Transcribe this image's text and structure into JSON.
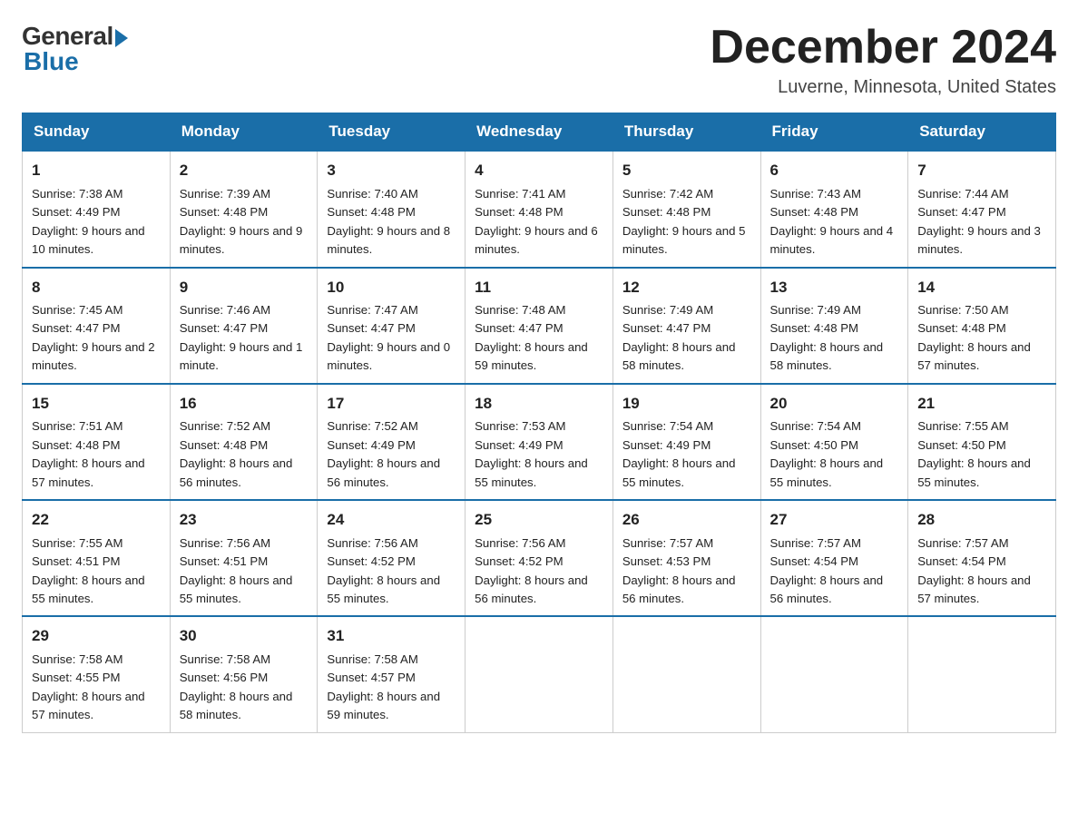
{
  "header": {
    "logo_general": "General",
    "logo_blue": "Blue",
    "month_title": "December 2024",
    "location": "Luverne, Minnesota, United States"
  },
  "days_of_week": [
    "Sunday",
    "Monday",
    "Tuesday",
    "Wednesday",
    "Thursday",
    "Friday",
    "Saturday"
  ],
  "weeks": [
    [
      {
        "day": "1",
        "sunrise": "7:38 AM",
        "sunset": "4:49 PM",
        "daylight": "9 hours and 10 minutes."
      },
      {
        "day": "2",
        "sunrise": "7:39 AM",
        "sunset": "4:48 PM",
        "daylight": "9 hours and 9 minutes."
      },
      {
        "day": "3",
        "sunrise": "7:40 AM",
        "sunset": "4:48 PM",
        "daylight": "9 hours and 8 minutes."
      },
      {
        "day": "4",
        "sunrise": "7:41 AM",
        "sunset": "4:48 PM",
        "daylight": "9 hours and 6 minutes."
      },
      {
        "day": "5",
        "sunrise": "7:42 AM",
        "sunset": "4:48 PM",
        "daylight": "9 hours and 5 minutes."
      },
      {
        "day": "6",
        "sunrise": "7:43 AM",
        "sunset": "4:48 PM",
        "daylight": "9 hours and 4 minutes."
      },
      {
        "day": "7",
        "sunrise": "7:44 AM",
        "sunset": "4:47 PM",
        "daylight": "9 hours and 3 minutes."
      }
    ],
    [
      {
        "day": "8",
        "sunrise": "7:45 AM",
        "sunset": "4:47 PM",
        "daylight": "9 hours and 2 minutes."
      },
      {
        "day": "9",
        "sunrise": "7:46 AM",
        "sunset": "4:47 PM",
        "daylight": "9 hours and 1 minute."
      },
      {
        "day": "10",
        "sunrise": "7:47 AM",
        "sunset": "4:47 PM",
        "daylight": "9 hours and 0 minutes."
      },
      {
        "day": "11",
        "sunrise": "7:48 AM",
        "sunset": "4:47 PM",
        "daylight": "8 hours and 59 minutes."
      },
      {
        "day": "12",
        "sunrise": "7:49 AM",
        "sunset": "4:47 PM",
        "daylight": "8 hours and 58 minutes."
      },
      {
        "day": "13",
        "sunrise": "7:49 AM",
        "sunset": "4:48 PM",
        "daylight": "8 hours and 58 minutes."
      },
      {
        "day": "14",
        "sunrise": "7:50 AM",
        "sunset": "4:48 PM",
        "daylight": "8 hours and 57 minutes."
      }
    ],
    [
      {
        "day": "15",
        "sunrise": "7:51 AM",
        "sunset": "4:48 PM",
        "daylight": "8 hours and 57 minutes."
      },
      {
        "day": "16",
        "sunrise": "7:52 AM",
        "sunset": "4:48 PM",
        "daylight": "8 hours and 56 minutes."
      },
      {
        "day": "17",
        "sunrise": "7:52 AM",
        "sunset": "4:49 PM",
        "daylight": "8 hours and 56 minutes."
      },
      {
        "day": "18",
        "sunrise": "7:53 AM",
        "sunset": "4:49 PM",
        "daylight": "8 hours and 55 minutes."
      },
      {
        "day": "19",
        "sunrise": "7:54 AM",
        "sunset": "4:49 PM",
        "daylight": "8 hours and 55 minutes."
      },
      {
        "day": "20",
        "sunrise": "7:54 AM",
        "sunset": "4:50 PM",
        "daylight": "8 hours and 55 minutes."
      },
      {
        "day": "21",
        "sunrise": "7:55 AM",
        "sunset": "4:50 PM",
        "daylight": "8 hours and 55 minutes."
      }
    ],
    [
      {
        "day": "22",
        "sunrise": "7:55 AM",
        "sunset": "4:51 PM",
        "daylight": "8 hours and 55 minutes."
      },
      {
        "day": "23",
        "sunrise": "7:56 AM",
        "sunset": "4:51 PM",
        "daylight": "8 hours and 55 minutes."
      },
      {
        "day": "24",
        "sunrise": "7:56 AM",
        "sunset": "4:52 PM",
        "daylight": "8 hours and 55 minutes."
      },
      {
        "day": "25",
        "sunrise": "7:56 AM",
        "sunset": "4:52 PM",
        "daylight": "8 hours and 56 minutes."
      },
      {
        "day": "26",
        "sunrise": "7:57 AM",
        "sunset": "4:53 PM",
        "daylight": "8 hours and 56 minutes."
      },
      {
        "day": "27",
        "sunrise": "7:57 AM",
        "sunset": "4:54 PM",
        "daylight": "8 hours and 56 minutes."
      },
      {
        "day": "28",
        "sunrise": "7:57 AM",
        "sunset": "4:54 PM",
        "daylight": "8 hours and 57 minutes."
      }
    ],
    [
      {
        "day": "29",
        "sunrise": "7:58 AM",
        "sunset": "4:55 PM",
        "daylight": "8 hours and 57 minutes."
      },
      {
        "day": "30",
        "sunrise": "7:58 AM",
        "sunset": "4:56 PM",
        "daylight": "8 hours and 58 minutes."
      },
      {
        "day": "31",
        "sunrise": "7:58 AM",
        "sunset": "4:57 PM",
        "daylight": "8 hours and 59 minutes."
      },
      null,
      null,
      null,
      null
    ]
  ],
  "labels": {
    "sunrise": "Sunrise:",
    "sunset": "Sunset:",
    "daylight": "Daylight:"
  }
}
